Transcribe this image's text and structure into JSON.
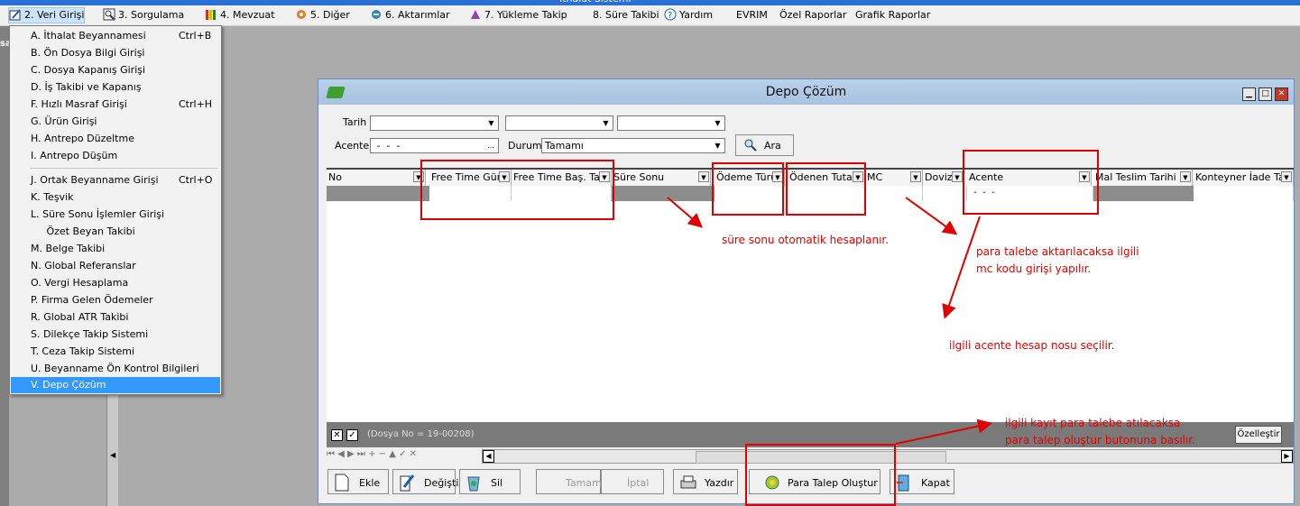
{
  "menubar": {
    "items": [
      {
        "label": "2.  Veri Girişi"
      },
      {
        "label": "3.  Sorgulama"
      },
      {
        "label": "4.  Mevzuat"
      },
      {
        "label": "5.  Diğer"
      },
      {
        "label": "6.  Aktarımlar"
      },
      {
        "label": "7.  Yükleme Takip"
      },
      {
        "label": "8. Süre Takibi"
      },
      {
        "label": "Yardım"
      },
      {
        "label": "EVRIM"
      },
      {
        "label": "Özel Raporlar"
      },
      {
        "label": "Grafik Raporlar"
      }
    ]
  },
  "dropdown": {
    "items": [
      {
        "label": "A.  İthalat Beyannamesi",
        "shortcut": "Ctrl+B"
      },
      {
        "label": "B.  Ön Dosya Bilgi Girişi",
        "shortcut": ""
      },
      {
        "label": "C.  Dosya Kapanış Girişi",
        "shortcut": ""
      },
      {
        "label": "D.  İş Takibi ve Kapanış",
        "shortcut": ""
      },
      {
        "label": "F.  Hızlı Masraf Girişi",
        "shortcut": "Ctrl+H"
      },
      {
        "label": "G.  Ürün Girişi",
        "shortcut": ""
      },
      {
        "label": "H.   Antrepo Düzeltme",
        "shortcut": ""
      },
      {
        "label": "I.   Antrepo Düşüm",
        "shortcut": ""
      },
      {
        "label": "J.  Ortak Beyanname Girişi",
        "shortcut": "Ctrl+O"
      },
      {
        "label": "K.  Teşvik",
        "shortcut": ""
      },
      {
        "label": "L.  Süre Sonu İşlemler Girişi",
        "shortcut": ""
      },
      {
        "label": "     Özet Beyan Takibi",
        "shortcut": ""
      },
      {
        "label": "M.  Belge Takibi",
        "shortcut": ""
      },
      {
        "label": "N.  Global Referanslar",
        "shortcut": ""
      },
      {
        "label": "O. Vergi Hesaplama",
        "shortcut": ""
      },
      {
        "label": "P. Firma Gelen Ödemeler",
        "shortcut": ""
      },
      {
        "label": "R. Global ATR Takibi",
        "shortcut": ""
      },
      {
        "label": "S. Dilekçe Takip Sistemi",
        "shortcut": ""
      },
      {
        "label": "T. Ceza Takip Sistemi",
        "shortcut": ""
      },
      {
        "label": "U. Beyanname Ön Kontrol Bilgileri",
        "shortcut": ""
      },
      {
        "label": "V. Depo Çözüm",
        "shortcut": ""
      }
    ]
  },
  "window": {
    "title": "Depo Çözüm",
    "filters": {
      "tarih_label": "Tarih",
      "acente_label": "Acente",
      "acente_value": " -  -  -",
      "acente_dots": "...",
      "durum_label": "Durum",
      "durum_value": "Tamamı",
      "search_button": "Ara"
    },
    "grid": {
      "columns": [
        "No",
        "Free Time Gün",
        "Free Time Baş. Tar",
        "Süre Sonu",
        "Ödeme Türü",
        "Ödenen Tutar",
        "MC",
        "Doviz",
        "Acente",
        "Mal Teslim Tarihi",
        "Konteyner İade Tar"
      ],
      "row_acente": " -  -  -"
    },
    "footer": {
      "dosya_text": "(Dosya No = 19-00208)",
      "ozellestir": "Özelleştir",
      "nav": "⏮ ◀ ▶ ⏭ + − ▲ ✓ ✕"
    },
    "buttons": {
      "ekle": "Ekle",
      "degistir": "Değiştir",
      "sil": "Sil",
      "tamam": "Tamam",
      "iptal": "İptal",
      "yazdir": "Yazdır",
      "para_talep": "Para Talep Oluştur",
      "kapat": "Kapat"
    }
  },
  "annotations": {
    "sure_sonu": "süre sonu otomatik hesaplanır.",
    "para_talebe_1": "para talebe aktarılacaksa ilgili",
    "para_talebe_2": "mc kodu girişi yapılır.",
    "acente_hesap": "ilgili acente hesap nosu seçilir.",
    "kayit_1": "ilgili kayıt para talebe atılacaksa",
    "kayit_2": "para talep oluştur butonuna basılır.",
    "color": "#e10000"
  }
}
